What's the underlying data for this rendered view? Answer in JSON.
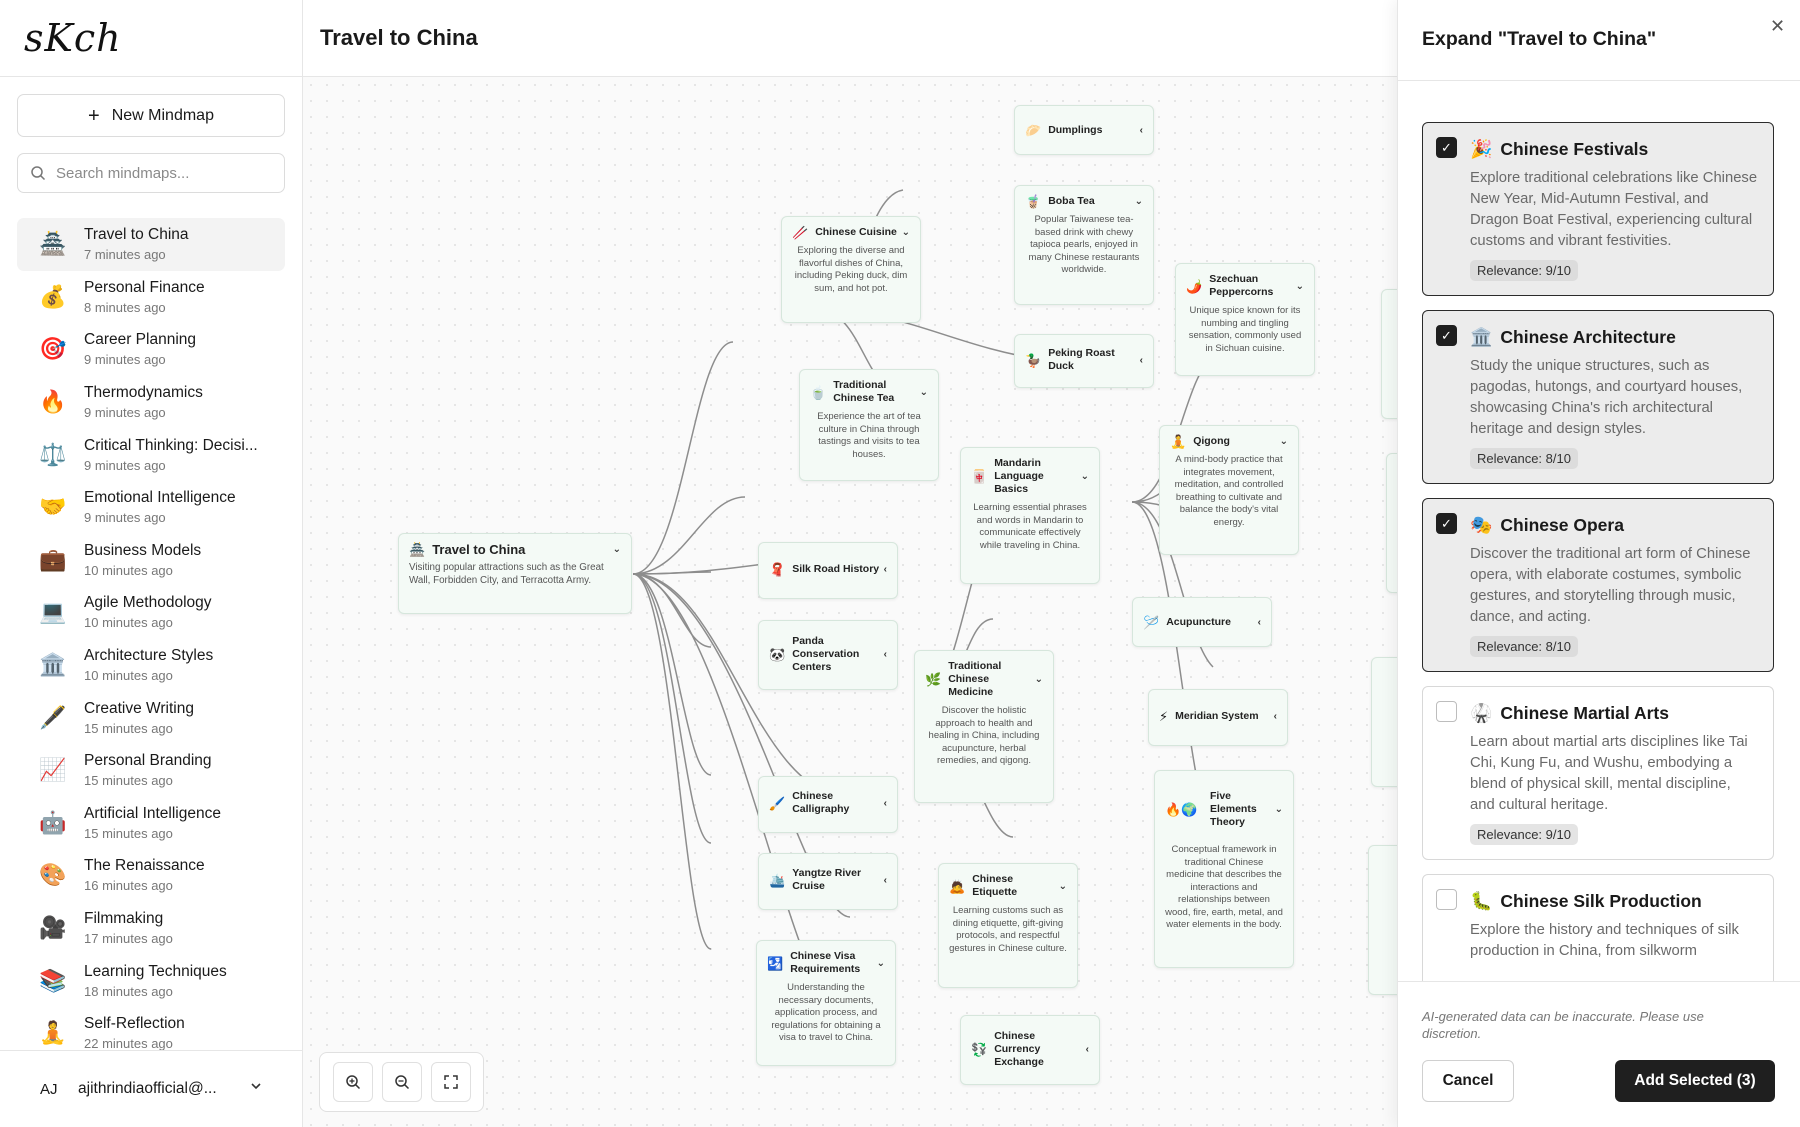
{
  "app": {
    "logo": "sKch",
    "window_title": "Travel to China"
  },
  "sidebar": {
    "new_button": "New Mindmap",
    "search_placeholder": "Search mindmaps...",
    "items": [
      {
        "emoji": "🏯",
        "title": "Travel to China",
        "time": "7 minutes ago",
        "active": true
      },
      {
        "emoji": "💰",
        "title": "Personal Finance",
        "time": "8 minutes ago"
      },
      {
        "emoji": "🎯",
        "title": "Career Planning",
        "time": "9 minutes ago"
      },
      {
        "emoji": "🔥",
        "title": "Thermodynamics",
        "time": "9 minutes ago"
      },
      {
        "emoji": "⚖️",
        "title": "Critical Thinking: Decisi...",
        "time": "9 minutes ago"
      },
      {
        "emoji": "🤝",
        "title": "Emotional Intelligence",
        "time": "9 minutes ago"
      },
      {
        "emoji": "💼",
        "title": "Business Models",
        "time": "10 minutes ago"
      },
      {
        "emoji": "💻",
        "title": "Agile Methodology",
        "time": "10 minutes ago"
      },
      {
        "emoji": "🏛️",
        "title": "Architecture Styles",
        "time": "10 minutes ago"
      },
      {
        "emoji": "🖋️",
        "title": "Creative Writing",
        "time": "15 minutes ago"
      },
      {
        "emoji": "📈",
        "title": "Personal Branding",
        "time": "15 minutes ago"
      },
      {
        "emoji": "🤖",
        "title": "Artificial Intelligence",
        "time": "15 minutes ago"
      },
      {
        "emoji": "🎨",
        "title": "The Renaissance",
        "time": "16 minutes ago"
      },
      {
        "emoji": "🎥",
        "title": "Filmmaking",
        "time": "17 minutes ago"
      },
      {
        "emoji": "📚",
        "title": "Learning Techniques",
        "time": "18 minutes ago"
      },
      {
        "emoji": "🧘",
        "title": "Self-Reflection",
        "time": "22 minutes ago"
      }
    ],
    "user": {
      "initials": "AJ",
      "email": "ajithrindiaofficial@..."
    }
  },
  "mindmap": {
    "title": "Travel to China",
    "nodes": {
      "root": {
        "icon": "🏯",
        "title": "Travel to China",
        "desc": "Visiting popular attractions such as the Great Wall, Forbidden City, and Terracotta Army."
      },
      "cuisine": {
        "icon": "🥢",
        "title": "Chinese Cuisine",
        "desc": "Exploring the diverse and flavorful dishes of China, including Peking duck, dim sum, and hot pot."
      },
      "dumplings": {
        "icon": "🥟",
        "title": "Dumplings"
      },
      "boba": {
        "icon": "🧋",
        "title": "Boba Tea",
        "desc": "Popular Taiwanese tea-based drink with chewy tapioca pearls, enjoyed in many Chinese restaurants worldwide."
      },
      "szechuan": {
        "icon": "🌶️",
        "title": "Szechuan Peppercorns",
        "desc": "Unique spice known for its numbing and tingling sensation, commonly used in Sichuan cuisine."
      },
      "peking": {
        "icon": "🦆",
        "title": "Peking Roast Duck"
      },
      "tea": {
        "icon": "🍵",
        "title": "Traditional Chinese Tea",
        "desc": "Experience the art of tea culture in China through tastings and visits to tea houses."
      },
      "mandarin": {
        "icon": "🀄",
        "title": "Mandarin Language Basics",
        "desc": "Learning essential phrases and words in Mandarin to communicate effectively while traveling in China."
      },
      "qigong": {
        "icon": "🧘",
        "title": "Qigong",
        "desc": "A mind-body practice that integrates movement, meditation, and controlled breathing to cultivate and balance the body's vital energy."
      },
      "silk": {
        "icon": "🧣",
        "title": "Silk Road History"
      },
      "panda": {
        "icon": "🐼",
        "title": "Panda Conservation Centers"
      },
      "tcm": {
        "icon": "🌿",
        "title": "Traditional Chinese Medicine",
        "desc": "Discover the holistic approach to health and healing in China, including acupuncture, herbal remedies, and qigong."
      },
      "acupuncture": {
        "icon": "🪡",
        "title": "Acupuncture"
      },
      "meridian": {
        "icon": "⚡",
        "title": "Meridian System"
      },
      "five": {
        "icon": "🔥🌍",
        "title": "Five Elements Theory",
        "desc": "Conceptual framework in traditional Chinese medicine that describes the interactions and relationships between wood, fire, earth, metal, and water elements in the body."
      },
      "calligraphy": {
        "icon": "🖌️",
        "title": "Chinese Calligraphy"
      },
      "yangtze": {
        "icon": "🛳️",
        "title": "Yangtze River Cruise"
      },
      "etiquette": {
        "icon": "🙇",
        "title": "Chinese Etiquette",
        "desc": "Learning customs such as dining etiquette, gift-giving protocols, and respectful gestures in Chinese culture."
      },
      "visa": {
        "icon": "🛂",
        "title": "Chinese Visa Requirements",
        "desc": "Understanding the necessary documents, application process, and regulations for obtaining a visa to travel to China."
      },
      "currency": {
        "icon": "💱",
        "title": "Chinese Currency Exchange"
      }
    }
  },
  "panel": {
    "title": "Expand \"Travel to China\"",
    "cards": [
      {
        "checked": true,
        "icon": "🎉",
        "title": "Chinese Festivals",
        "desc": "Explore traditional celebrations like Chinese New Year, Mid-Autumn Festival, and Dragon Boat Festival, experiencing cultural customs and vibrant festivities.",
        "relevance": "Relevance: 9/10"
      },
      {
        "checked": true,
        "icon": "🏛️",
        "title": "Chinese Architecture",
        "desc": "Study the unique structures, such as pagodas, hutongs, and courtyard houses, showcasing China's rich architectural heritage and design styles.",
        "relevance": "Relevance: 8/10"
      },
      {
        "checked": true,
        "icon": "🎭",
        "title": "Chinese Opera",
        "desc": "Discover the traditional art form of Chinese opera, with elaborate costumes, symbolic gestures, and storytelling through music, dance, and acting.",
        "relevance": "Relevance: 8/10"
      },
      {
        "checked": false,
        "icon": "🥋",
        "title": "Chinese Martial Arts",
        "desc": "Learn about martial arts disciplines like Tai Chi, Kung Fu, and Wushu, embodying a blend of physical skill, mental discipline, and cultural heritage.",
        "relevance": "Relevance: 9/10"
      },
      {
        "checked": false,
        "icon": "🐛",
        "title": "Chinese Silk Production",
        "desc": "Explore the history and techniques of silk production in China, from silkworm",
        "relevance": ""
      }
    ],
    "disclaimer": "AI-generated data can be inaccurate. Please use discretion.",
    "cancel": "Cancel",
    "add": "Add Selected (3)"
  }
}
